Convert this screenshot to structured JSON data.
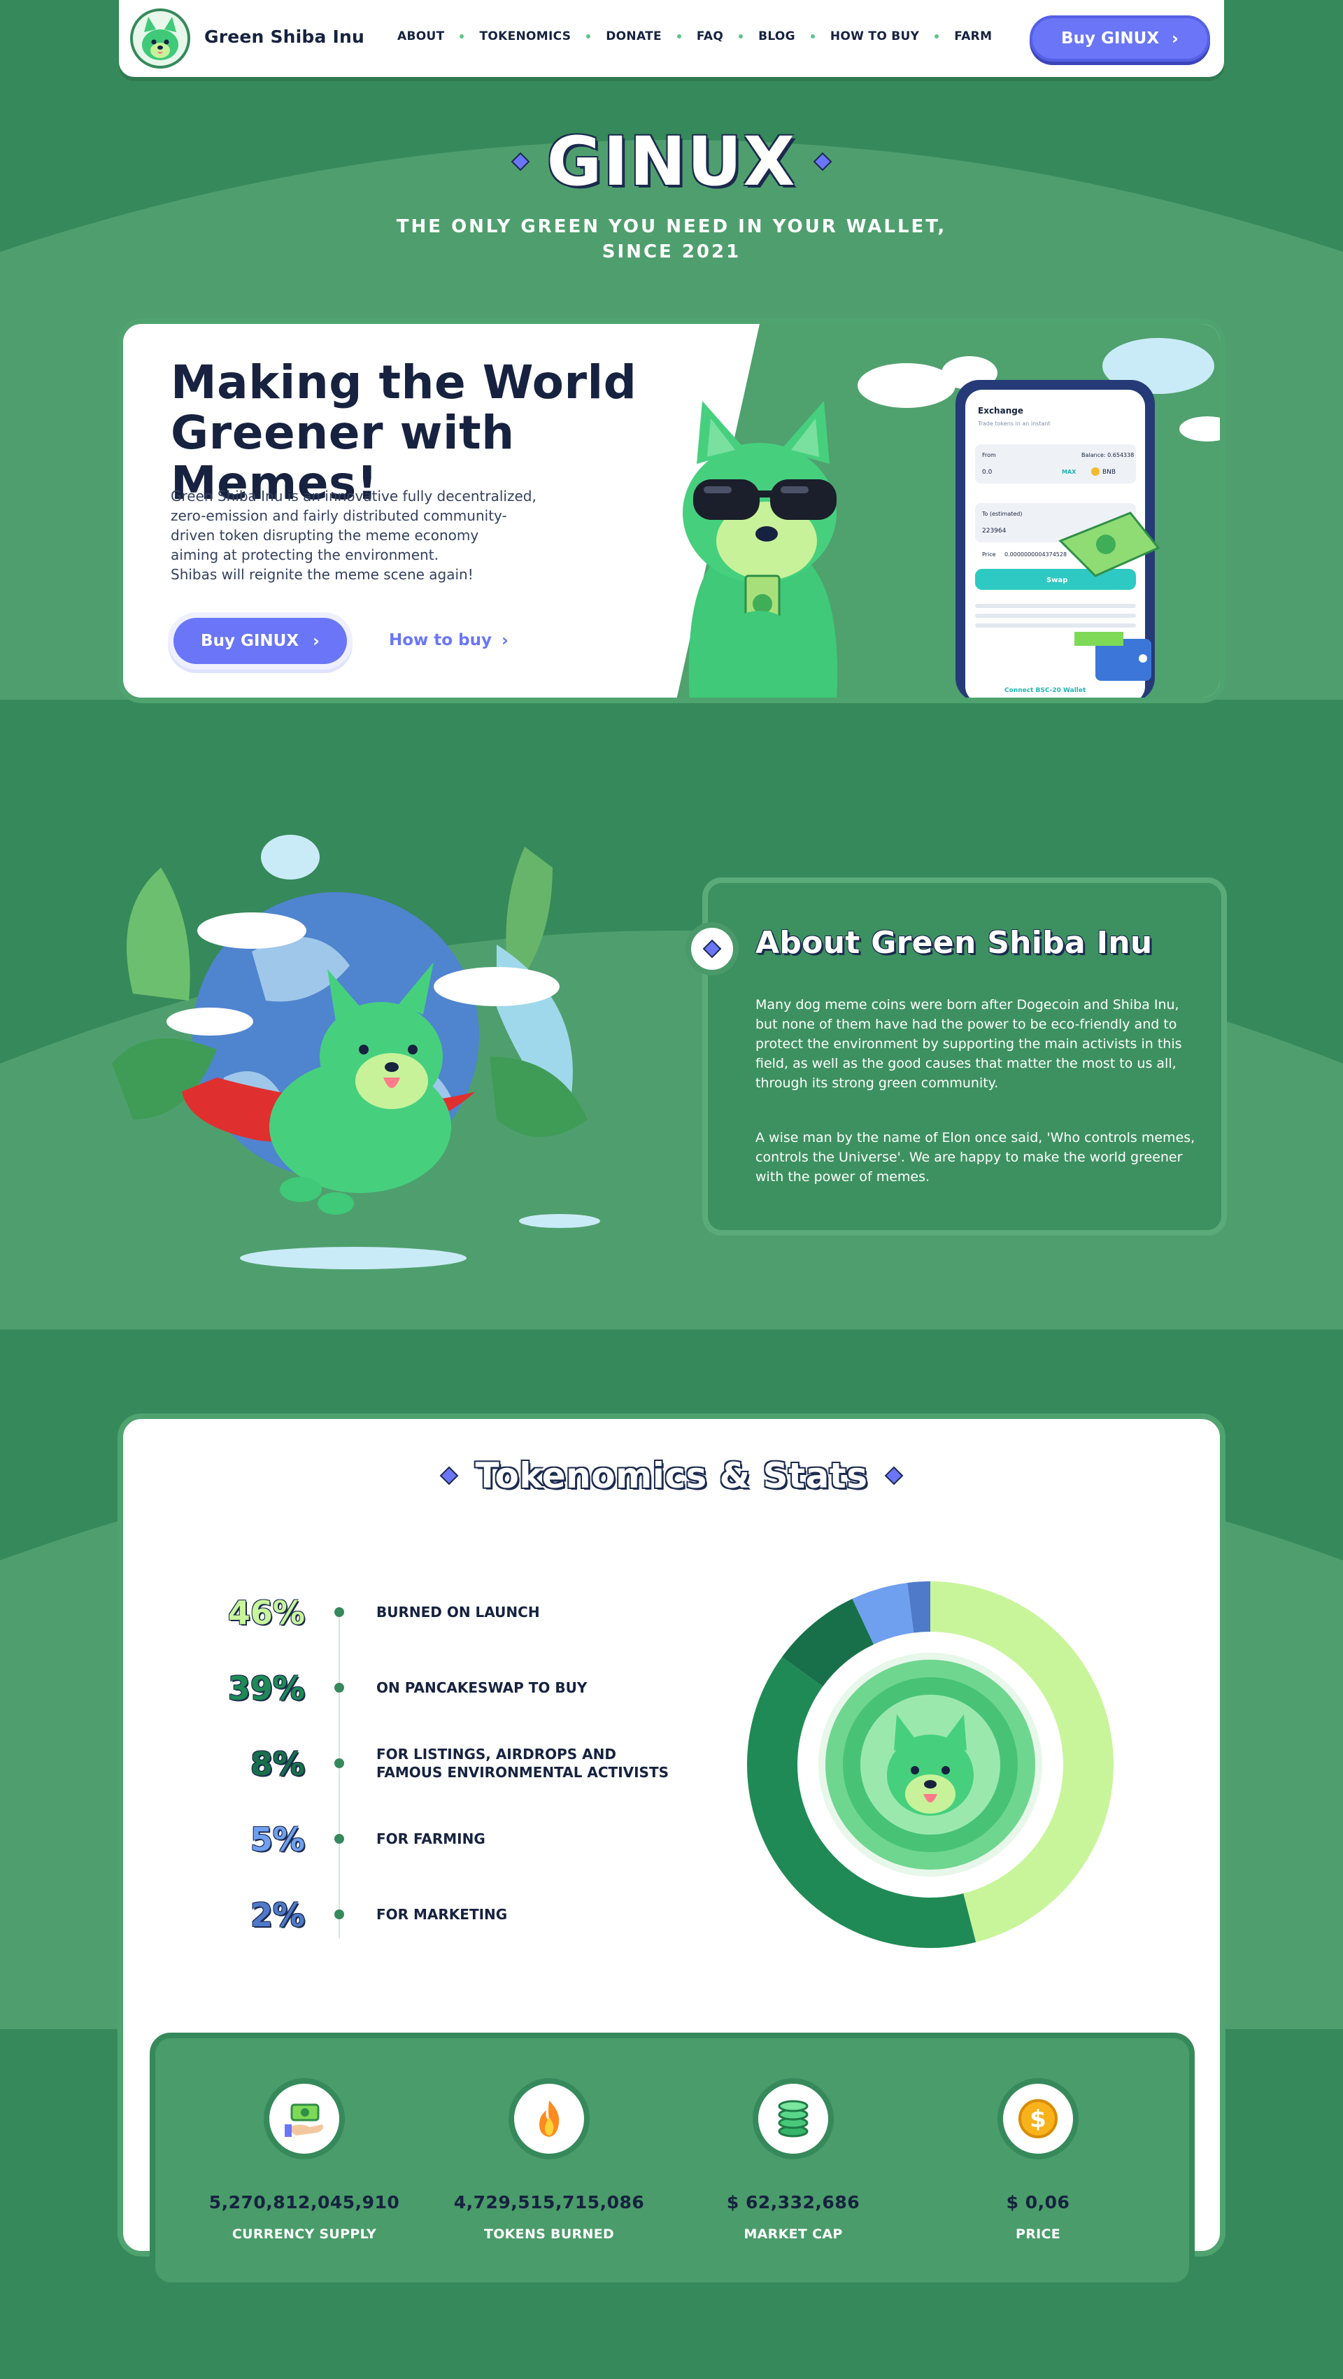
{
  "colors": {
    "background": "#36895a",
    "accent": "#6a76f7",
    "navy": "#16223f",
    "white": "#ffffff",
    "lime": "#c8f59a",
    "green_dark": "#1f8a55"
  },
  "nav": {
    "brand": "Green Shiba Inu",
    "logo_icon": "shiba-logo-icon",
    "links": [
      "ABOUT",
      "TOKENOMICS",
      "DONATE",
      "FAQ",
      "BLOG",
      "HOW TO BUY",
      "FARM"
    ],
    "buy_label": "Buy GINUX"
  },
  "hero": {
    "title": "GINUX",
    "subtitle_line1": "THE ONLY GREEN YOU NEED IN YOUR WALLET,",
    "subtitle_line2": "SINCE 2021"
  },
  "intro": {
    "heading": "Making the World Greener with Memes!",
    "body_lines": [
      "Green Shiba Inu is an innovative fully decentralized,",
      "zero-emission and fairly distributed community-",
      "driven token disrupting the meme economy",
      "aiming at protecting the environment.",
      "Shibas will reignite the meme scene again!"
    ],
    "buy_label": "Buy GINUX",
    "how_to_label": "How to buy"
  },
  "exchange_widget": {
    "title": "Exchange",
    "subtitle": "Trade tokens in an instant",
    "from_label": "From",
    "balance_label": "Balance: 0.654338",
    "from_value": "0.0",
    "max_label": "MAX",
    "from_token": "BNB",
    "to_label": "To (estimated)",
    "to_value": "223964",
    "price_label": "Price",
    "price_value": "0.0000000004374528",
    "swap_label": "Swap",
    "connect_label": "Connect BSC-20 Wallet"
  },
  "about": {
    "heading": "About Green Shiba Inu",
    "paragraph1": "Many dog meme coins were born after Dogecoin and Shiba Inu, but none of them have had the power to be eco-friendly and to protect the environment by supporting the main activists in this field, as well as the good causes that matter the most to us all, through its strong green community.",
    "paragraph2": "A wise man by the name of Elon once said, 'Who controls memes, controls the Universe'. We are happy to make the world greener with the power of memes."
  },
  "tokenomics": {
    "heading": "Tokenomics & Stats",
    "rows": [
      {
        "pct": "46%",
        "label_line1": "BURNED ON LAUNCH",
        "label_line2": "",
        "color": "#c8f59a"
      },
      {
        "pct": "39%",
        "label_line1": "ON PANCAKESWAP TO BUY",
        "label_line2": "",
        "color": "#1f8a55"
      },
      {
        "pct": "8%",
        "label_line1": "FOR LISTINGS, AIRDROPS AND",
        "label_line2": "FAMOUS ENVIRONMENTAL ACTIVISTS",
        "color": "#17704a"
      },
      {
        "pct": "5%",
        "label_line1": "FOR FARMING",
        "label_line2": "",
        "color": "#6fa0ef"
      },
      {
        "pct": "2%",
        "label_line1": "FOR MARKETING",
        "label_line2": "",
        "color": "#4f7ac9"
      }
    ]
  },
  "chart_data": {
    "type": "pie",
    "categories": [
      "BURNED ON LAUNCH",
      "ON PANCAKESWAP TO BUY",
      "FOR LISTINGS, AIRDROPS AND FAMOUS ENVIRONMENTAL ACTIVISTS",
      "FOR FARMING",
      "FOR MARKETING"
    ],
    "values": [
      46,
      39,
      8,
      5,
      2
    ],
    "colors": [
      "#c8f59a",
      "#1f8a55",
      "#17704a",
      "#6fa0ef",
      "#4f7ac9"
    ],
    "title": "",
    "xlabel": "",
    "ylabel": ""
  },
  "stats": [
    {
      "value": "5,270,812,045,910",
      "label": "CURRENCY SUPPLY",
      "icon": "money-hand-icon"
    },
    {
      "value": "4,729,515,715,086",
      "label": "TOKENS BURNED",
      "icon": "fire-icon"
    },
    {
      "value": "$ 62,332,686",
      "label": "MARKET CAP",
      "icon": "coin-stack-icon"
    },
    {
      "value": "$ 0,06",
      "label": "PRICE",
      "icon": "dollar-coin-icon"
    }
  ]
}
